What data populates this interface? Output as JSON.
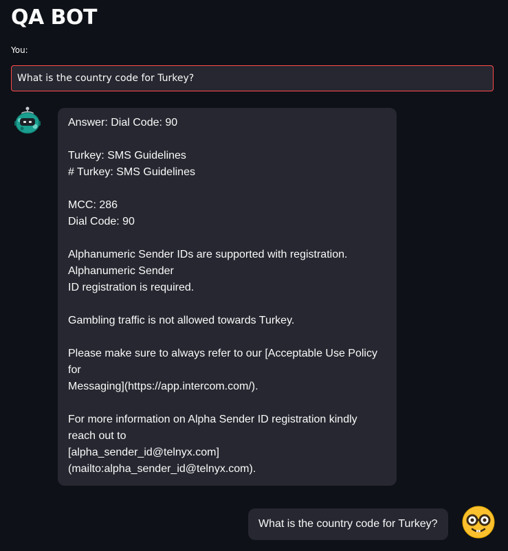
{
  "app": {
    "title": "QA BOT"
  },
  "query": {
    "label": "You:",
    "value": "What is the country code for Turkey?"
  },
  "messages": {
    "bot": {
      "avatar_icon": "robot-avatar-icon",
      "text": "Answer: Dial Code: 90\n\nTurkey: SMS Guidelines\n# Turkey: SMS Guidelines\n\nMCC: 286\nDial Code: 90\n\nAlphanumeric Sender IDs are supported with registration.\nAlphanumeric Sender\nID registration is required.\n\nGambling traffic is not allowed towards Turkey.\n\nPlease make sure to always refer to our [Acceptable Use Policy\nfor\nMessaging](https://app.intercom.com/).\n\nFor more information on Alpha Sender ID registration kindly\nreach out to\n[alpha_sender_id@telnyx.com]\n(mailto:alpha_sender_id@telnyx.com)."
    },
    "user": {
      "avatar_icon": "nerd-face-avatar-icon",
      "text": "What is the country code for Turkey?"
    }
  },
  "colors": {
    "background": "#0e1117",
    "bubble": "#262730",
    "input_border_focus": "#ff4b4b",
    "text": "#fafafa"
  }
}
